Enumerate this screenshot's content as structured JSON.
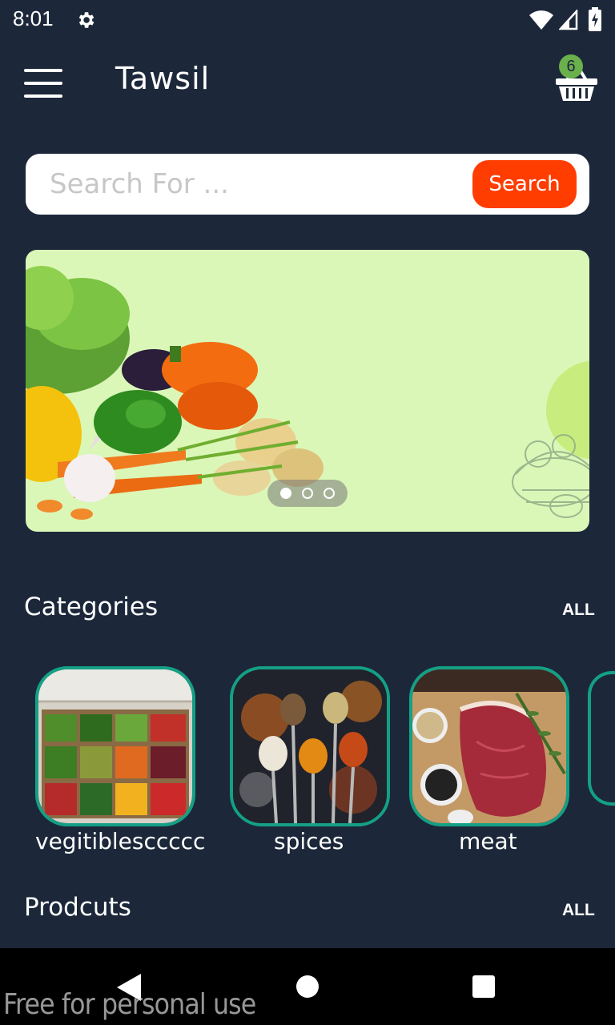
{
  "status_bar": {
    "time": "8:01",
    "icons": [
      "gear-icon",
      "wifi-icon",
      "signal-icon",
      "battery-icon"
    ]
  },
  "app_bar": {
    "title": "Tawsil",
    "cart_count": "6",
    "menu_icon": "hamburger-icon",
    "cart_icon": "basket-icon"
  },
  "search": {
    "placeholder": "Search For ...",
    "value": "",
    "button_label": "Search"
  },
  "banner": {
    "slide_count": 3,
    "active_slide": 1
  },
  "categories": {
    "title": "Categories",
    "all_label": "ALL",
    "items": [
      {
        "label": "vegitiblesccccc"
      },
      {
        "label": "spices"
      },
      {
        "label": "meat"
      }
    ]
  },
  "products": {
    "title": "Prodcuts",
    "all_label": "ALL"
  },
  "watermark": "Free for personal use",
  "colors": {
    "background": "#1c283a",
    "accent": "#ff3d00",
    "category_border": "#14a085",
    "banner_bg": "#dbf7b8"
  }
}
